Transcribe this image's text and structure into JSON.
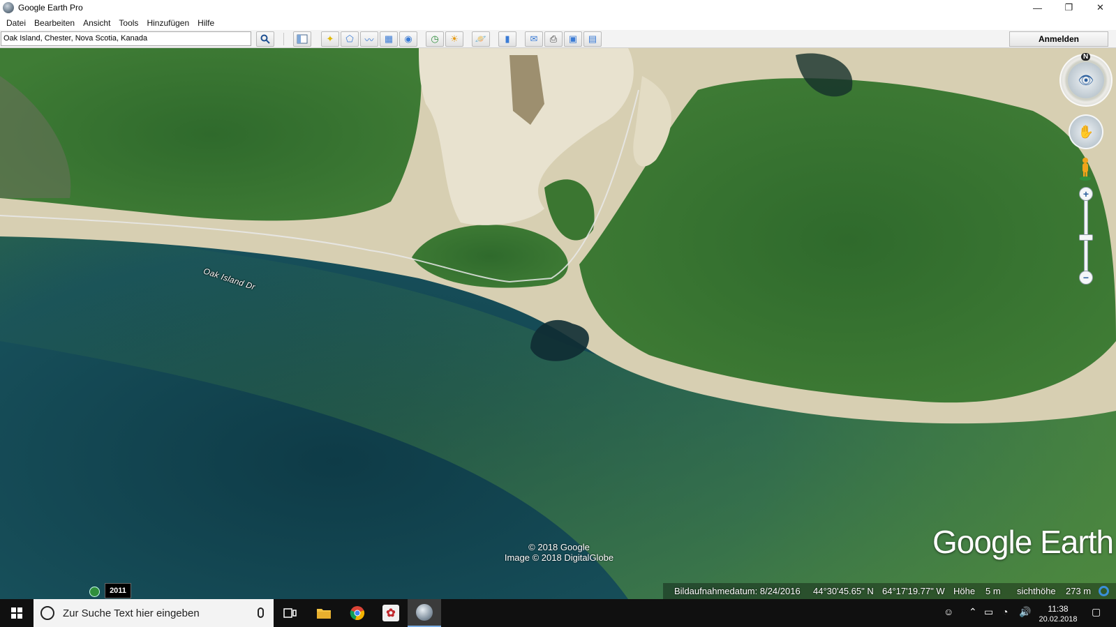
{
  "window": {
    "title": "Google Earth Pro"
  },
  "window_controls": {
    "minimize": "—",
    "maximize": "❐",
    "close": "✕"
  },
  "menu": [
    {
      "label": "Datei"
    },
    {
      "label": "Bearbeiten"
    },
    {
      "label": "Ansicht"
    },
    {
      "label": "Tools"
    },
    {
      "label": "Hinzufügen"
    },
    {
      "label": "Hilfe"
    }
  ],
  "search": {
    "value": "Oak Island, Chester, Nova Scotia, Kanada"
  },
  "toolbar": {
    "signin_label": "Anmelden",
    "icons": [
      "search-icon",
      "sidebar-icon",
      "placemark-icon",
      "polygon-icon",
      "path-icon",
      "image-overlay-icon",
      "record-tour-icon",
      "historical-imagery-icon",
      "sunlight-icon",
      "planets-icon",
      "ruler-icon",
      "email-icon",
      "print-icon",
      "save-image-icon",
      "maps-icon"
    ]
  },
  "map": {
    "road_label": "Oak Island Dr",
    "copyright_line1": "© 2018 Google",
    "copyright_line2": "Image © 2018 DigitalGlobe",
    "brand": "Google Earth",
    "north_label": "N"
  },
  "status": {
    "imagery_year": "2011",
    "imagery_date": "Bildaufnahmedatum: 8/24/2016",
    "lat": "44°30'45.65\" N",
    "lon": "64°17'19.77\" W",
    "elevation_label": "Höhe",
    "elevation_value": "5 m",
    "eye_alt_label": "sichthöhe",
    "eye_alt_value": "273 m"
  },
  "taskbar": {
    "search_placeholder": "Zur Suche Text hier eingeben",
    "time": "11:38",
    "date": "20.02.2018",
    "apps": [
      "task-view-icon",
      "file-explorer-icon",
      "chrome-icon",
      "app-icon",
      "google-earth-icon"
    ]
  },
  "colors": {
    "water_deep": "#1d4a55",
    "forest": "#3f7a33",
    "sand": "#d9d1b5",
    "taskbar": "#101010",
    "accent": "#7aaee6"
  }
}
